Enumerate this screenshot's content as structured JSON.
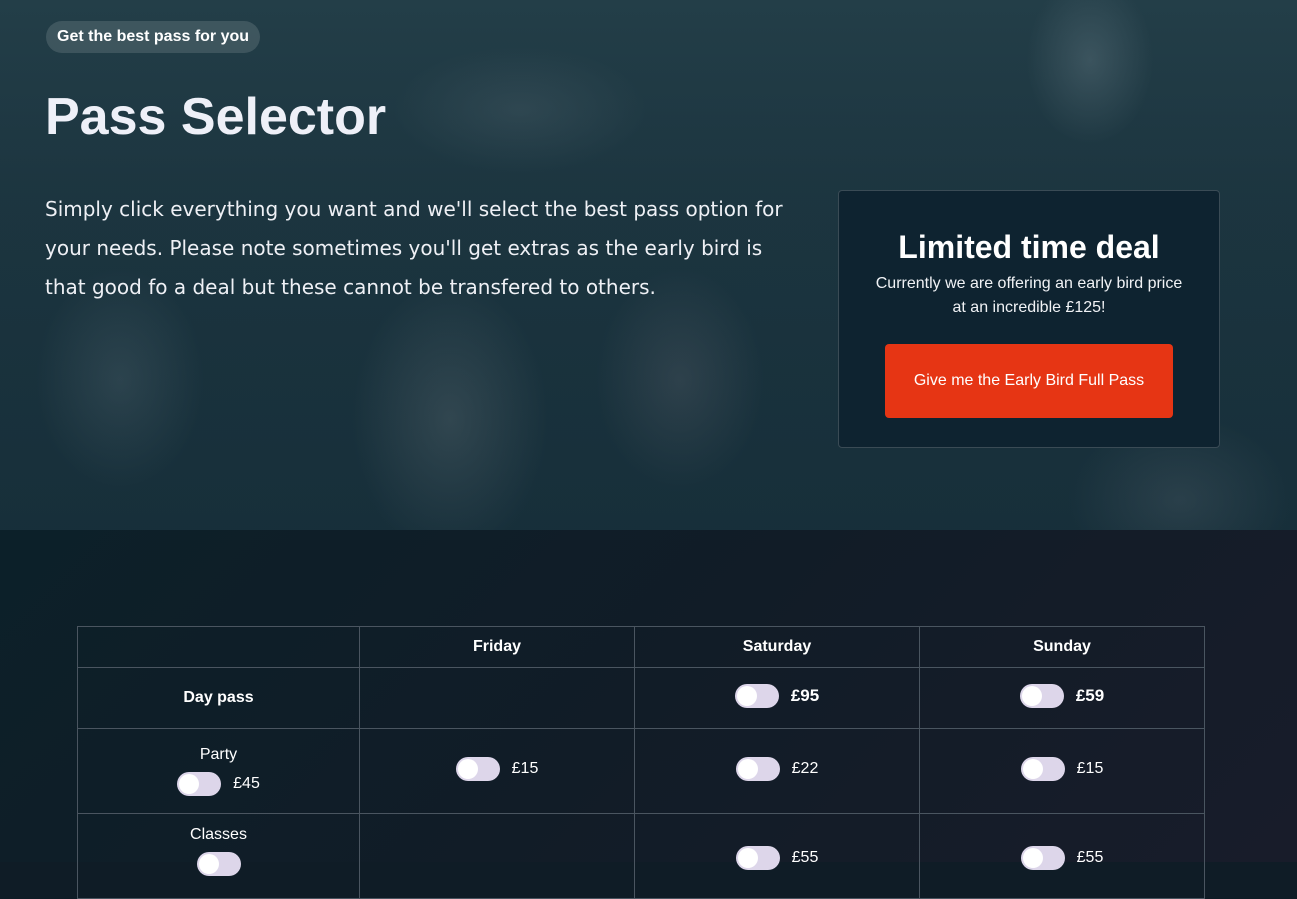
{
  "hero": {
    "badge": "Get the best pass for you",
    "title": "Pass Selector",
    "intro": "Simply click everything you want and we'll select the best pass option for your needs. Please note sometimes you'll get extras as the early bird is that good fo a deal but these cannot be transfered to others."
  },
  "deal": {
    "title": "Limited time deal",
    "text": "Currently we are offering an early bird price at an incredible £125!",
    "button": "Give me the Early Bird Full Pass",
    "button_color": "#e63514"
  },
  "table": {
    "headers": [
      "",
      "Friday",
      "Saturday",
      "Sunday"
    ],
    "day_pass": {
      "label": "Day pass",
      "friday": "",
      "saturday": "£95",
      "sunday": "£59"
    },
    "party": {
      "label": "Party",
      "all": "£45",
      "friday": "£15",
      "saturday": "£22",
      "sunday": "£15"
    },
    "classes": {
      "label": "Classes",
      "saturday": "£55",
      "sunday": "£55"
    }
  },
  "colors": {
    "page_bg": "#0f1c26",
    "toggle_track": "#ddd6ea"
  }
}
